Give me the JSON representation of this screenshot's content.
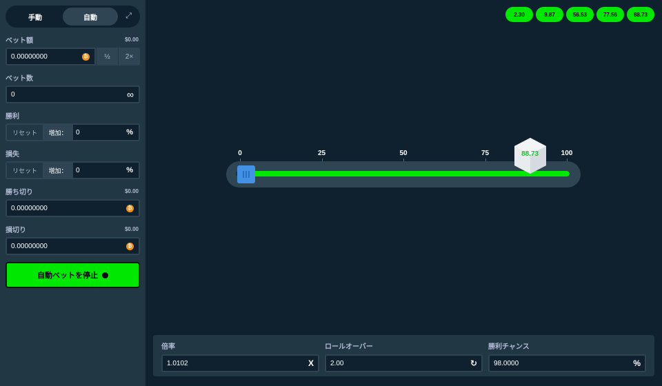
{
  "mode": {
    "manual": "手動",
    "auto": "自動"
  },
  "bet_amount": {
    "label": "ベット額",
    "usd": "$0.00",
    "value": "0.00000000",
    "half": "½",
    "double": "2×"
  },
  "bet_count": {
    "label": "ベット数",
    "value": "0"
  },
  "on_win": {
    "label": "勝利",
    "reset": "リセット",
    "increase": "増加：",
    "value": "0",
    "unit": "%"
  },
  "on_loss": {
    "label": "損失",
    "reset": "リセット",
    "increase": "増加：",
    "value": "0",
    "unit": "%"
  },
  "stop_profit": {
    "label": "勝ち切り",
    "usd": "$0.00",
    "value": "0.00000000"
  },
  "stop_loss": {
    "label": "損切り",
    "usd": "$0.00",
    "value": "0.00000000"
  },
  "stop_button": {
    "label": "自動ベットを停止"
  },
  "history": [
    "2.30",
    "9.87",
    "56.53",
    "77.56",
    "88.73"
  ],
  "slider": {
    "ticks": [
      "0",
      "25",
      "50",
      "75",
      "100"
    ],
    "value": 2,
    "result": "88.73",
    "result_value": 88.73
  },
  "payout": {
    "multiplier_label": "倍率",
    "multiplier_value": "1.0102",
    "multiplier_icon": "x-icon",
    "rollover_label": "ロールオーバー",
    "rollover_value": "2.00",
    "rollover_icon": "refresh-icon",
    "chance_label": "勝利チャンス",
    "chance_value": "98.0000",
    "chance_unit": "%"
  },
  "colors": {
    "accent": "#00e701",
    "bg": "#0f212e",
    "panel": "#213743",
    "handle": "#4391e7"
  }
}
